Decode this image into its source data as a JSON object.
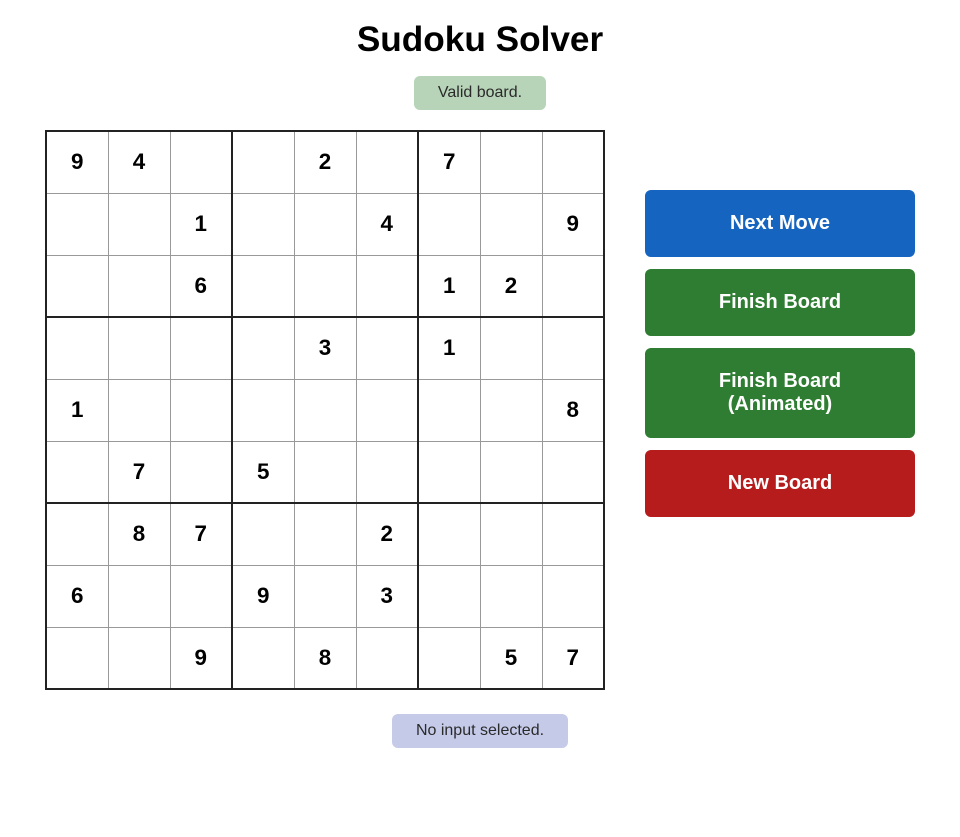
{
  "title": "Sudoku Solver",
  "valid_badge": "Valid board.",
  "status_badge": "No input selected.",
  "buttons": {
    "next_move": "Next Move",
    "finish_board": "Finish Board",
    "finish_board_animated": "Finish Board\n(Animated)",
    "new_board": "New Board"
  },
  "board": [
    [
      "9",
      "4",
      "",
      "",
      "2",
      "",
      "7",
      "",
      ""
    ],
    [
      "",
      "",
      "1",
      "",
      "",
      "4",
      "",
      "",
      "9"
    ],
    [
      "",
      "",
      "6",
      "",
      "",
      "",
      "1",
      "2",
      ""
    ],
    [
      "",
      "",
      "",
      "",
      "3",
      "",
      "1",
      "",
      ""
    ],
    [
      "1",
      "",
      "",
      "",
      "",
      "",
      "",
      "",
      "8"
    ],
    [
      "",
      "7",
      "",
      "5",
      "",
      "",
      "",
      "",
      ""
    ],
    [
      "",
      "8",
      "7",
      "",
      "",
      "2",
      "",
      "",
      ""
    ],
    [
      "6",
      "",
      "",
      "9",
      "",
      "3",
      "",
      "",
      ""
    ],
    [
      "",
      "",
      "9",
      "",
      "8",
      "",
      "",
      "5",
      "7"
    ]
  ]
}
